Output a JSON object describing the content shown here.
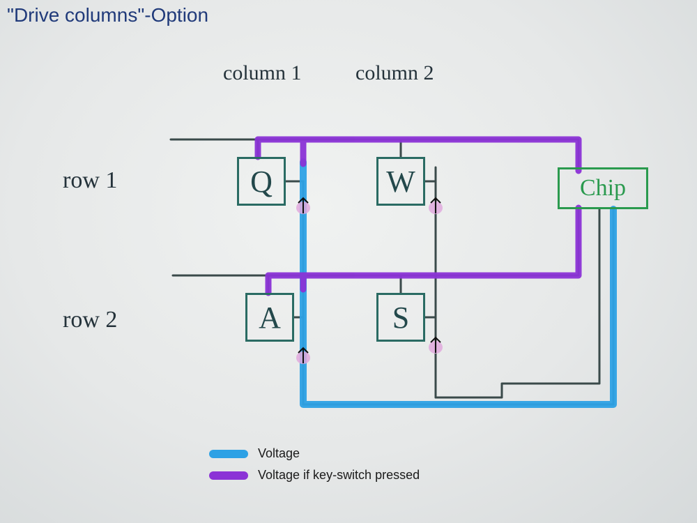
{
  "title": "\"Drive columns\"-Option",
  "columns": {
    "col1": "column 1",
    "col2": "column 2"
  },
  "rows": {
    "row1": "row 1",
    "row2": "row 2"
  },
  "keys": {
    "Q": "Q",
    "W": "W",
    "A": "A",
    "S": "S"
  },
  "chip_label": "Chip",
  "legend": {
    "voltage": "Voltage",
    "voltage_pressed": "Voltage if key-switch pressed"
  },
  "colors": {
    "voltage": "#2da1e5",
    "voltage_pressed": "#8b33d6",
    "wire": "#3a4a4a",
    "key_border": "#2a6b63",
    "chip_border": "#2a9a4e",
    "text": "#24323a",
    "title": "#203a7a",
    "diode_body": "#e0a9dd"
  }
}
